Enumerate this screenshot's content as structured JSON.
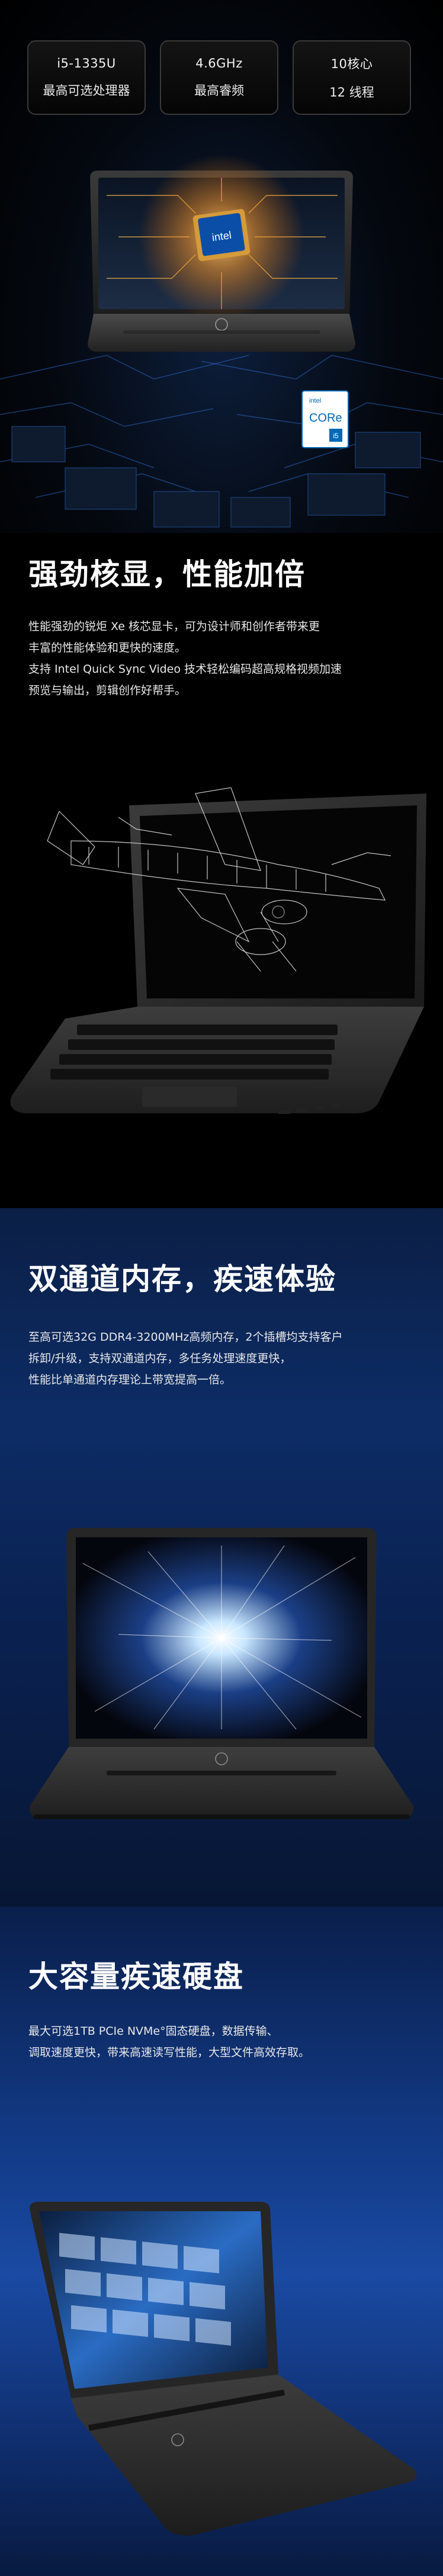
{
  "specs": [
    {
      "value": "i5-1335U",
      "label": "最高可选处理器"
    },
    {
      "value": "4.6GHz",
      "label": "最高睿频"
    },
    {
      "value": "10核心",
      "label": "12 线程"
    }
  ],
  "chip_text": "intel",
  "badge": {
    "brand": "intel",
    "line": "CORe",
    "gen": "i5"
  },
  "hp_logo": "hp",
  "graphics": {
    "title": "强劲核显，性能加倍",
    "lines": [
      "性能强劲的锐炬 Xe 核芯显卡，可为设计师和创作者带来更",
      "丰富的性能体验和更快的速度。",
      "支持 Intel Quick Sync Video 技术轻松编码超高规格视频加速",
      "预览与输出，剪辑创作好帮手。"
    ]
  },
  "memory": {
    "title": "双通道内存，疾速体验",
    "lines": [
      "至高可选32G DDR4-3200MHz高频内存，2个插槽均支持客户",
      "拆卸/升级，支持双通道内存，多任务处理速度更快，",
      "性能比单通道内存理论上带宽提高一倍。"
    ]
  },
  "storage": {
    "title": "大容量疾速硬盘",
    "lines": [
      "最大可选1TB PCIe NVMe°固态硬盘，数据传输、",
      "调取速度更快，带来高速读写性能，大型文件高效存取。"
    ]
  }
}
